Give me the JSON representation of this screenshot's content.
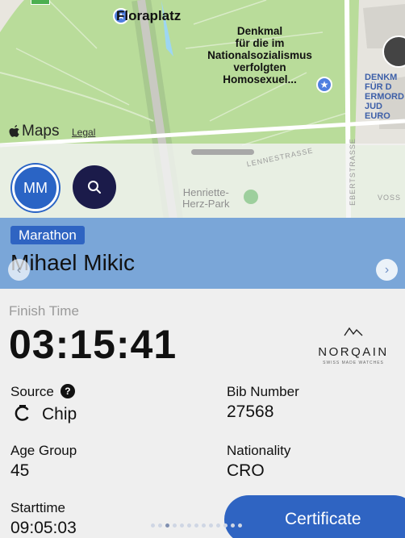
{
  "map": {
    "poi_floraplatz": "Floraplatz",
    "poi_denkmal": "Denkmal\nfür die im\nNationalsozialismus\nverfolgten\nHomosexuel...",
    "poi_side": "DENKM\nFÜR D\nERMORD\nJUD\nEURO",
    "maps_label": "Maps",
    "legal_link": "Legal",
    "street_1": "LENNESTRASSE",
    "street_2": "EBERTSTRASSE",
    "street_3": "VOSS",
    "park_name": "Henriette-\nHerz-Park"
  },
  "sheet": {
    "avatar_initials": "MM"
  },
  "athlete": {
    "event_tag": "Marathon",
    "name": "Mihael Mikic"
  },
  "result": {
    "finish_time_label": "Finish Time",
    "finish_time": "03:15:41",
    "sponsor": "NORQAIN",
    "sponsor_sub": "SWISS MADE WATCHES",
    "source_label": "Source",
    "source_value": "Chip",
    "bib_label": "Bib Number",
    "bib_value": "27568",
    "age_group_label": "Age Group",
    "age_group_value": "45",
    "nationality_label": "Nationality",
    "nationality_value": "CRO",
    "starttime_label": "Starttime",
    "starttime_value": "09:05:03"
  },
  "actions": {
    "certificate_label": "Certificate"
  },
  "pager": {
    "total": 13,
    "active": 2
  },
  "colors": {
    "brand_blue": "#2f64c2",
    "hero_blue": "#7aa6d8",
    "map_green": "#b9dc9a"
  }
}
